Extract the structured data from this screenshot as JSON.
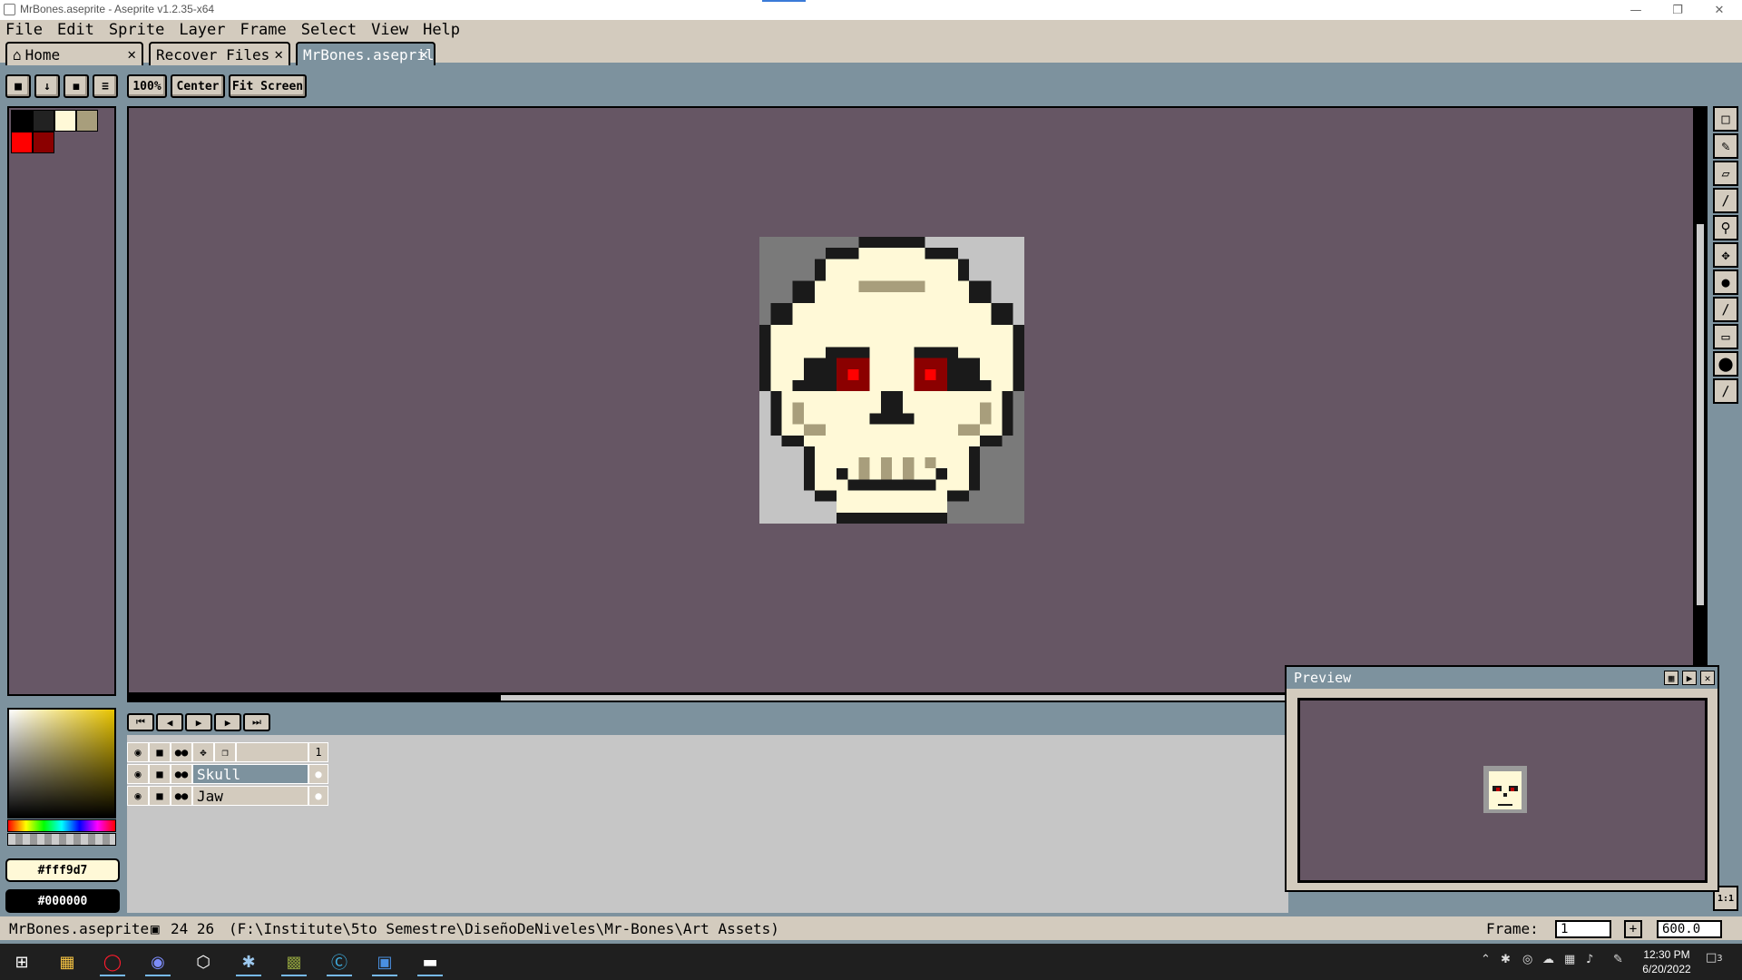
{
  "window": {
    "title": "MrBones.aseprite - Aseprite v1.2.35-x64"
  },
  "menu": [
    "File",
    "Edit",
    "Sprite",
    "Layer",
    "Frame",
    "Select",
    "View",
    "Help"
  ],
  "tabs": [
    {
      "label": "Home",
      "icon": "home-icon"
    },
    {
      "label": "Recover Files"
    },
    {
      "label": "MrBones.asepril",
      "active": true
    }
  ],
  "toolbar": {
    "zoom": "100%",
    "center": "Center",
    "fit": "Fit Screen"
  },
  "palette": [
    "#000000",
    "#222222",
    "#fff9d7",
    "#a89e7c",
    "#ff0000",
    "#8b0000"
  ],
  "colors": {
    "foreground": "#fff9d7",
    "background": "#000000"
  },
  "timeline": {
    "frame_header": "1",
    "layers": [
      {
        "name": "Skull",
        "selected": true
      },
      {
        "name": "Jaw",
        "selected": false
      }
    ]
  },
  "preview": {
    "title": "Preview",
    "ratio": "1:1"
  },
  "status": {
    "file": "MrBones.aseprite",
    "coords": "24 26",
    "path": "(F:\\Institute\\5to Semestre\\DiseñoDeNiveles\\Mr-Bones\\Art Assets)",
    "frame_label": "Frame:",
    "frame_value": "1",
    "zoom_value": "600.0"
  },
  "taskbar": {
    "time": "12:30 PM",
    "date": "6/20/2022",
    "notifications": "3"
  }
}
